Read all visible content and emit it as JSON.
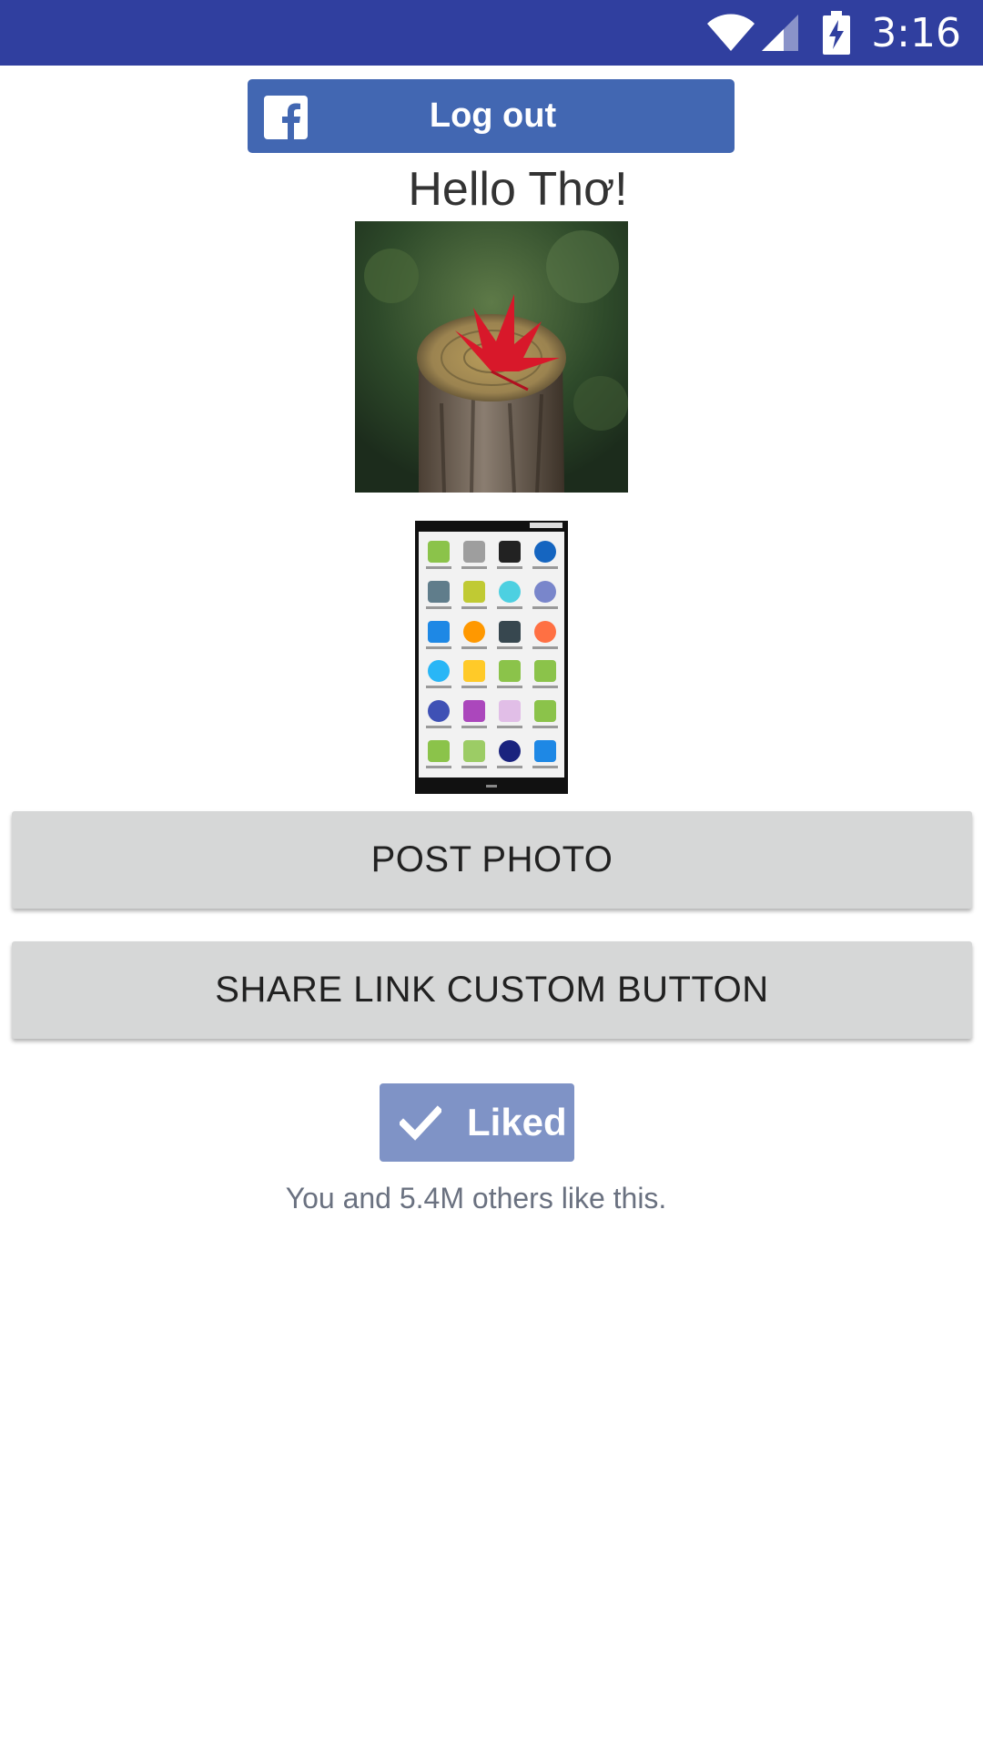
{
  "status_bar": {
    "time": "3:16",
    "icons": [
      "wifi-icon",
      "cell-signal-icon",
      "battery-charging-icon"
    ]
  },
  "login": {
    "logout_label": "Log out",
    "brand_icon": "facebook-icon",
    "brand_color": "#4267b2"
  },
  "greeting": "Hello Thơ!",
  "images": {
    "profile_picture": "red maple leaf on tree stump",
    "screenshot_thumbnail": "android app drawer screenshot"
  },
  "actions": {
    "post_photo_label": "POST PHOTO",
    "share_link_label": "SHARE LINK CUSTOM BUTTON"
  },
  "like": {
    "label": "Liked",
    "social_sentence": "You and 5.4M others like this.",
    "color": "#7f93c6"
  },
  "colors": {
    "status_bar": "#303f9f",
    "button_bg": "#d6d7d7"
  }
}
